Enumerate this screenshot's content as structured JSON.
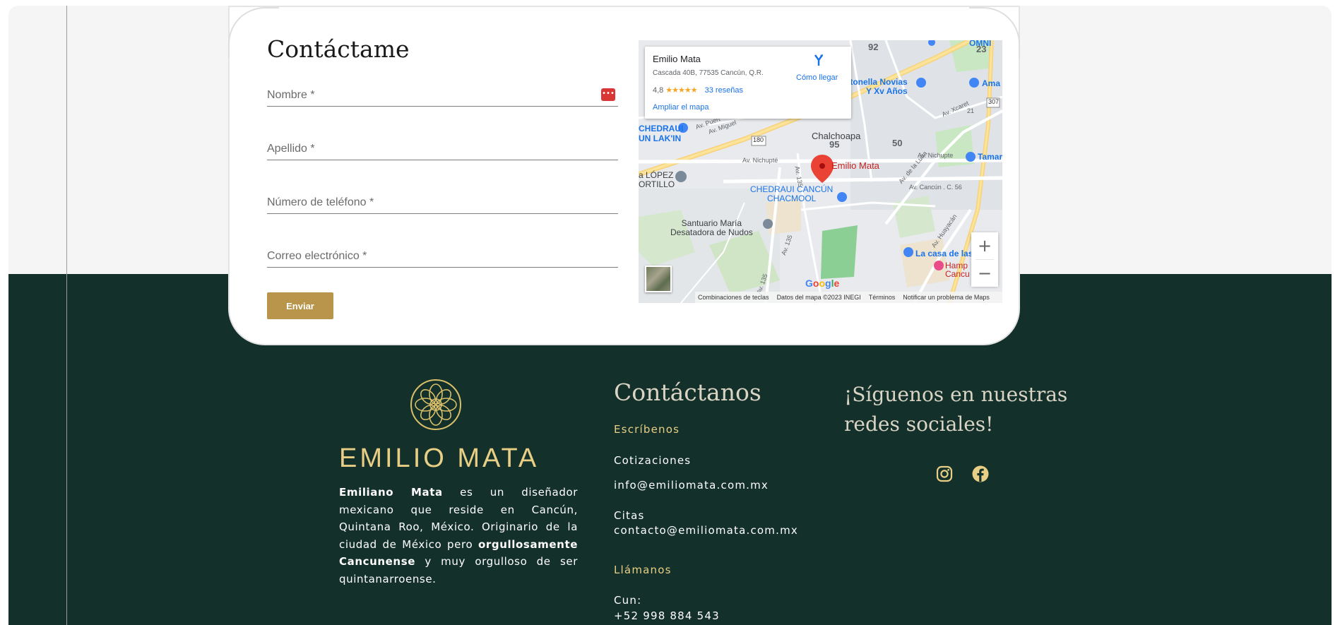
{
  "contact_form": {
    "title": "Contáctame",
    "fields": {
      "first_name_placeholder": "Nombre *",
      "last_name_placeholder": "Apellido *",
      "phone_placeholder": "Número de teléfono *",
      "email_placeholder": "Correo electrónico *"
    },
    "submit_label": "Enviar"
  },
  "map": {
    "info": {
      "name": "Emilio Mata",
      "address": "Cascada 40B, 77535 Cancún, Q.R.",
      "rating": "4,8",
      "stars": "★★★★★",
      "reviews": "33 reseñas",
      "enlarge": "Ampliar el mapa",
      "directions": "Cómo llegar"
    },
    "labels": {
      "pin": "Emilio Mata",
      "chalchoapa": "Chalchoapa",
      "chedraui_chacmool": "CHEDRAUI CANCÚN\nCHACMOOL",
      "chedraui_top": "CHEDRAUI",
      "lakin": "UN LAK'IN",
      "santuario": "Santuario María\nDesatadora de Nudos",
      "lopez": "a LÓPEZ\nORTILLO",
      "antonella": "ntonella Novias\nY Xv Años",
      "casa": "La casa de las",
      "hamp": "Hamp\nCancu",
      "tamar": "Tamar",
      "ama": "Ama",
      "omni": "OMNI",
      "nichupte1": "Av. Nichupté",
      "nichupte2": "Av. Nichupte",
      "xcaret": "Av. Xcaret",
      "cancun_c56": "Av. Cancún . C. 56",
      "huayacan": "Av. Huayacán",
      "la_luna": "Av. de la Luna",
      "av135a": "Av. 135",
      "av135b": "Av. 135",
      "av135c": "Av. 135",
      "miguel": "Av. Miguel",
      "pueblo": "Av. Puert",
      "n92": "92",
      "n23": "23",
      "n95": "95",
      "n50": "50",
      "n180": "180",
      "n307": "307",
      "n21": "21"
    },
    "google": "Google",
    "attribution": [
      "Combinaciones de teclas",
      "Datos del mapa ©2023 INEGI",
      "Términos",
      "Notificar un problema de Maps"
    ],
    "zoom_in": "+",
    "zoom_out": "−"
  },
  "footer": {
    "brand": "EMILIO MATA",
    "about": {
      "bold1": "Emiliano Mata",
      "text1": " es un diseñador mexicano que reside en Cancún, Quintana Roo, México. Originario de la ciudad de México pero ",
      "bold2": "orgullosamente Cancunense",
      "text2": " y muy orgulloso de ser quintanarroense."
    },
    "contact": {
      "title": "Contáctanos",
      "write_label": "Escríbenos",
      "quotes_label": "Cotizaciones",
      "quotes_email": "info@emiliomata.com.mx",
      "appointments_label": "Citas",
      "appointments_email": "contacto@emiliomata.com.mx",
      "call_label": "Llámanos",
      "city": "Cun:",
      "phone": "+52 998 884 543"
    },
    "social": {
      "title_line1": "¡Síguenos en nuestras",
      "title_line2": "redes sociales!"
    }
  },
  "colors": {
    "footer_bg": "#14302b",
    "gold": "#e8cf85",
    "button": "#b8954a"
  }
}
